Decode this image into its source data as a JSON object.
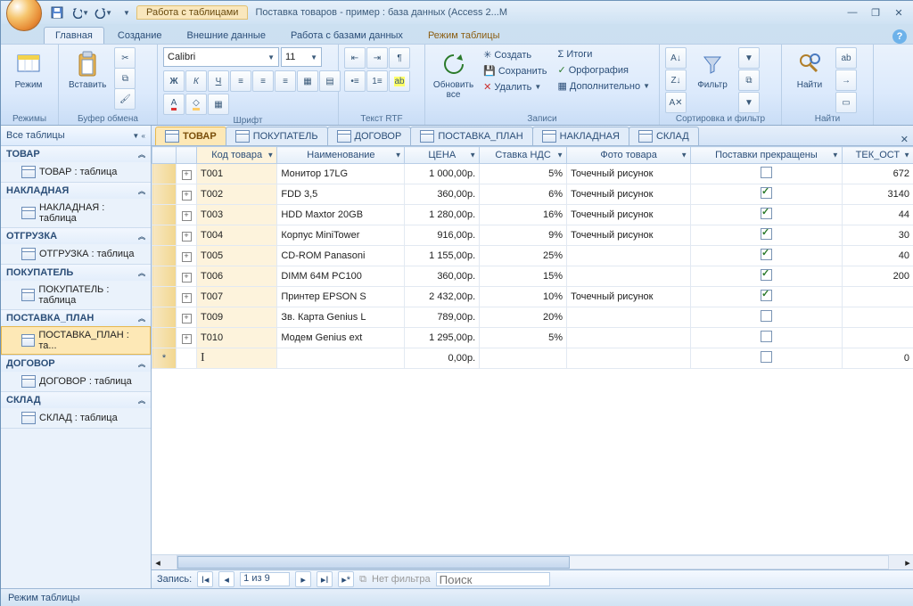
{
  "title": {
    "tools": "Работа с таблицами",
    "app": "Поставка товаров - пример : база данных (Access 2...M"
  },
  "tabs": {
    "home": "Главная",
    "create": "Создание",
    "external": "Внешние данные",
    "dbtools": "Работа с базами данных",
    "dsheet": "Режим таблицы"
  },
  "ribbon": {
    "views": {
      "label": "Режимы",
      "view": "Режим"
    },
    "clipboard": {
      "label": "Буфер обмена",
      "paste": "Вставить"
    },
    "font": {
      "label": "Шрифт",
      "name": "Calibri",
      "size": "11"
    },
    "rtf": {
      "label": "Текст RTF"
    },
    "records": {
      "label": "Записи",
      "refresh": "Обновить\nвсе",
      "new": "Создать",
      "save": "Сохранить",
      "delete": "Удалить",
      "totals": "Итоги",
      "spell": "Орфография",
      "more": "Дополнительно"
    },
    "sort": {
      "label": "Сортировка и фильтр",
      "filter": "Фильтр"
    },
    "find": {
      "label": "Найти",
      "find": "Найти"
    }
  },
  "nav": {
    "title": "Все таблицы",
    "groups": [
      {
        "name": "ТОВАР",
        "items": [
          "ТОВАР : таблица"
        ]
      },
      {
        "name": "НАКЛАДНАЯ",
        "items": [
          "НАКЛАДНАЯ : таблица"
        ]
      },
      {
        "name": "ОТГРУЗКА",
        "items": [
          "ОТГРУЗКА : таблица"
        ]
      },
      {
        "name": "ПОКУПАТЕЛЬ",
        "items": [
          "ПОКУПАТЕЛЬ : таблица"
        ]
      },
      {
        "name": "ПОСТАВКА_ПЛАН",
        "items": [
          "ПОСТАВКА_ПЛАН : та..."
        ],
        "sel": true
      },
      {
        "name": "ДОГОВОР",
        "items": [
          "ДОГОВОР : таблица"
        ]
      },
      {
        "name": "СКЛАД",
        "items": [
          "СКЛАД : таблица"
        ]
      }
    ]
  },
  "doctabs": [
    "ТОВАР",
    "ПОКУПАТЕЛЬ",
    "ДОГОВОР",
    "ПОСТАВКА_ПЛАН",
    "НАКЛАДНАЯ",
    "СКЛАД"
  ],
  "columns": [
    "Код товара",
    "Наименование",
    "ЦЕНА",
    "Ставка НДС",
    "Фото товара",
    "Поставки прекращены",
    "ТЕК_ОСТ"
  ],
  "rows": [
    {
      "code": "T001",
      "name": "Монитор 17LG",
      "price": "1 000,00р.",
      "vat": "5%",
      "photo": "Точечный рисунок",
      "stop": false,
      "rest": "672"
    },
    {
      "code": "T002",
      "name": "FDD 3,5",
      "price": "360,00р.",
      "vat": "6%",
      "photo": "Точечный рисунок",
      "stop": true,
      "rest": "3140"
    },
    {
      "code": "T003",
      "name": "HDD Maxtor 20GB",
      "price": "1 280,00р.",
      "vat": "16%",
      "photo": "Точечный рисунок",
      "stop": true,
      "rest": "44"
    },
    {
      "code": "T004",
      "name": "Корпус MiniTower",
      "price": "916,00р.",
      "vat": "9%",
      "photo": "Точечный рисунок",
      "stop": true,
      "rest": "30"
    },
    {
      "code": "T005",
      "name": "CD-ROM Panasoni",
      "price": "1 155,00р.",
      "vat": "25%",
      "photo": "",
      "stop": true,
      "rest": "40"
    },
    {
      "code": "T006",
      "name": "DIMM 64M PC100",
      "price": "360,00р.",
      "vat": "15%",
      "photo": "",
      "stop": true,
      "rest": "200"
    },
    {
      "code": "T007",
      "name": "Принтер EPSON S",
      "price": "2 432,00р.",
      "vat": "10%",
      "photo": "Точечный рисунок",
      "stop": true,
      "rest": ""
    },
    {
      "code": "T009",
      "name": "Зв. Карта Genius L",
      "price": "789,00р.",
      "vat": "20%",
      "photo": "",
      "stop": false,
      "rest": ""
    },
    {
      "code": "T010",
      "name": "Модем Genius ext",
      "price": "1 295,00р.",
      "vat": "5%",
      "photo": "",
      "stop": false,
      "rest": ""
    }
  ],
  "newrow": {
    "price": "0,00р.",
    "rest": "0"
  },
  "recnav": {
    "label": "Запись:",
    "pos": "1 из 9",
    "filter": "Нет фильтра",
    "search": "Поиск"
  },
  "status": "Режим таблицы"
}
